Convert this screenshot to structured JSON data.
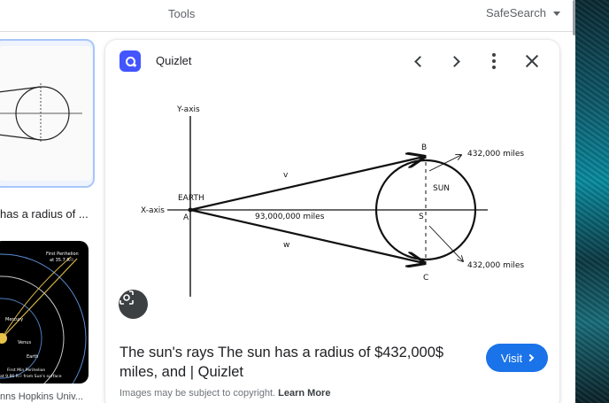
{
  "toolbar": {
    "tools": "Tools",
    "safesearch": "SafeSearch"
  },
  "results": [
    {
      "caption": "has a radius of ..."
    },
    {
      "caption": "nns Hopkins Univ..."
    }
  ],
  "thumb_labels": {
    "first_perihelion": "First Perihelion",
    "first_perihelion_dist": "at 35.7 R☉",
    "mercury": "Mercury",
    "venus": "Venus",
    "earth": "Earth",
    "final_perihelion": "First Min Perihelion",
    "final_perihelion_dist": "at 9.86 R☉ from Sun's surface"
  },
  "panel": {
    "source": "Quizlet",
    "title": "The sun's rays The sun has a radius of $432,000$ miles, and | Quizlet",
    "visit_label": "Visit",
    "copyright_prefix": "Images may be subject to copyright.",
    "learn_more": "Learn More"
  },
  "diagram": {
    "y_axis": "Y-axis",
    "x_axis": "X-axis",
    "earth": "EARTH",
    "point_a": "A",
    "point_b": "B",
    "point_c": "C",
    "point_s": "S",
    "sun": "SUN",
    "v": "v",
    "w": "w",
    "distance": "93,000,000 miles",
    "radius_top": "432,000 miles",
    "radius_bottom": "432,000 miles"
  },
  "colors": {
    "accent": "#1a73e8",
    "quizlet": "#4255ff"
  },
  "icons": [
    "quizlet-logo-icon",
    "chevron-left-icon",
    "chevron-right-icon",
    "more-vert-icon",
    "close-icon",
    "google-lens-icon",
    "chevron-right-small-icon"
  ]
}
